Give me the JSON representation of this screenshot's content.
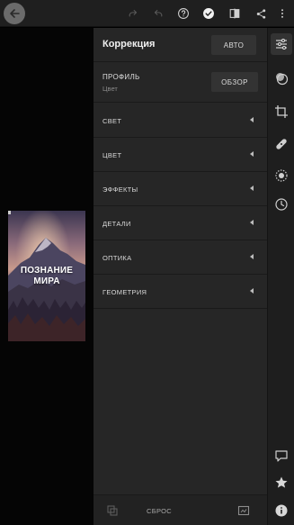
{
  "topbar": {
    "icons": [
      "back-arrow-icon",
      "redo-icon",
      "undo-icon",
      "help-icon",
      "checkmark-icon",
      "compare-icon",
      "share-icon",
      "more-vertical-icon"
    ]
  },
  "preview": {
    "photo_caption": "ПОЗНАНИЕ\nМИРА"
  },
  "panel": {
    "title": "Коррекция",
    "auto_label": "АВТО",
    "profile": {
      "label": "ПРОФИЛЬ",
      "value": "Цвет",
      "browse_label": "ОБЗОР"
    },
    "sections": [
      {
        "label": "СВЕТ"
      },
      {
        "label": "ЦВЕТ"
      },
      {
        "label": "ЭФФЕКТЫ"
      },
      {
        "label": "ДЕТАЛИ"
      },
      {
        "label": "ОПТИКА"
      },
      {
        "label": "ГЕОМЕТРИЯ"
      }
    ],
    "footer": {
      "reset_label": "СБРОС"
    }
  },
  "toolstrip": {
    "tools": [
      "adjust-sliders-icon",
      "presets-icon",
      "crop-icon",
      "healing-bandage-icon",
      "selective-icon",
      "history-icon"
    ],
    "bottom_tools": [
      "comment-icon",
      "star-icon",
      "info-icon"
    ]
  },
  "colors": {
    "panel_bg": "#262626",
    "topbar_bg": "#1f1f1f",
    "accent_white": "#ffffff"
  }
}
